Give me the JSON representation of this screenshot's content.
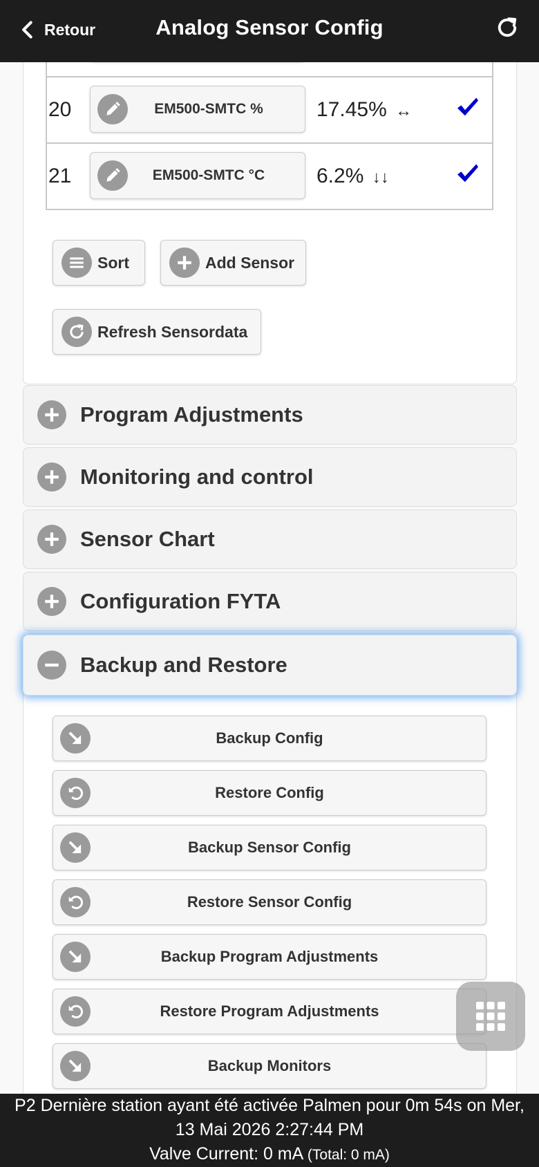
{
  "header": {
    "back_label": "Retour",
    "title": "Analog Sensor Config"
  },
  "sensors": [
    {
      "num": "20",
      "name": "EM500-SMTC %",
      "value": "17.45%",
      "trend": "↔"
    },
    {
      "num": "21",
      "name": "EM500-SMTC °C",
      "value": "6.2%",
      "trend": "↓↓"
    }
  ],
  "buttons": {
    "sort": "Sort",
    "add_sensor": "Add Sensor",
    "refresh_sensordata": "Refresh Sensordata"
  },
  "sections": [
    {
      "title": "Program Adjustments",
      "expanded": false
    },
    {
      "title": "Monitoring and control",
      "expanded": false
    },
    {
      "title": "Sensor Chart",
      "expanded": false
    },
    {
      "title": "Configuration FYTA",
      "expanded": false
    },
    {
      "title": "Backup and Restore",
      "expanded": true
    }
  ],
  "backup_actions": [
    {
      "label": "Backup Config",
      "icon": "arrow-down-right-icon"
    },
    {
      "label": "Restore Config",
      "icon": "undo-icon"
    },
    {
      "label": "Backup Sensor Config",
      "icon": "arrow-down-right-icon"
    },
    {
      "label": "Restore Sensor Config",
      "icon": "undo-icon"
    },
    {
      "label": "Backup Program Adjustments",
      "icon": "arrow-down-right-icon"
    },
    {
      "label": "Restore Program Adjustments",
      "icon": "undo-icon"
    },
    {
      "label": "Backup Monitors",
      "icon": "arrow-down-right-icon"
    }
  ],
  "footer": {
    "line1": "P2 Dernière station ayant été activée Palmen pour 0m 54s on Mer,",
    "line2": "13 Mai 2026 2:27:44 PM",
    "line3_main": "Valve Current: 0 mA",
    "line3_small": "(Total: 0 mA)"
  },
  "colors": {
    "header_bg": "#1d1d1d",
    "check": "#0000cc",
    "icon_circle": "#9a9a9a",
    "active_glow": "#388ee9"
  }
}
